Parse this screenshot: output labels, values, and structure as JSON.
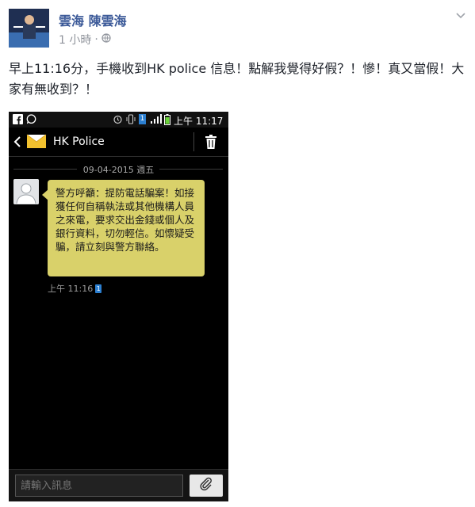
{
  "post": {
    "author": "雲海 陳雲海",
    "time": "1 小時",
    "text": "早上11:16分，手機收到HK police 信息！點解我覺得好假？！慘！真又當假！大家有無收到？！"
  },
  "phone": {
    "status_time": "上午 11:17",
    "sim_number": "1",
    "contact_name": "HK Police",
    "date_separator": "09-04-2015 週五",
    "message": "警方呼籲：提防電話騙案！如接獲任何自稱執法或其他機構人員之來電，要求交出金錢或個人及銀行資料，切勿輕信。如懷疑受騙，請立刻與警方聯絡。",
    "message_time": "上午 11:16",
    "input_placeholder": "請輸入訊息"
  },
  "colors": {
    "author": "#3b5998",
    "bubble": "#d9d16a",
    "phone_bg": "#000000"
  },
  "icons": [
    "facebook-icon",
    "whatsapp-icon",
    "alarm-icon",
    "vibrate-icon",
    "sim-icon",
    "signal-icon",
    "battery-icon",
    "back-arrow-icon",
    "envelope-icon",
    "trash-icon",
    "contact-icon",
    "paperclip-icon",
    "globe-icon",
    "chevron-down-icon"
  ]
}
